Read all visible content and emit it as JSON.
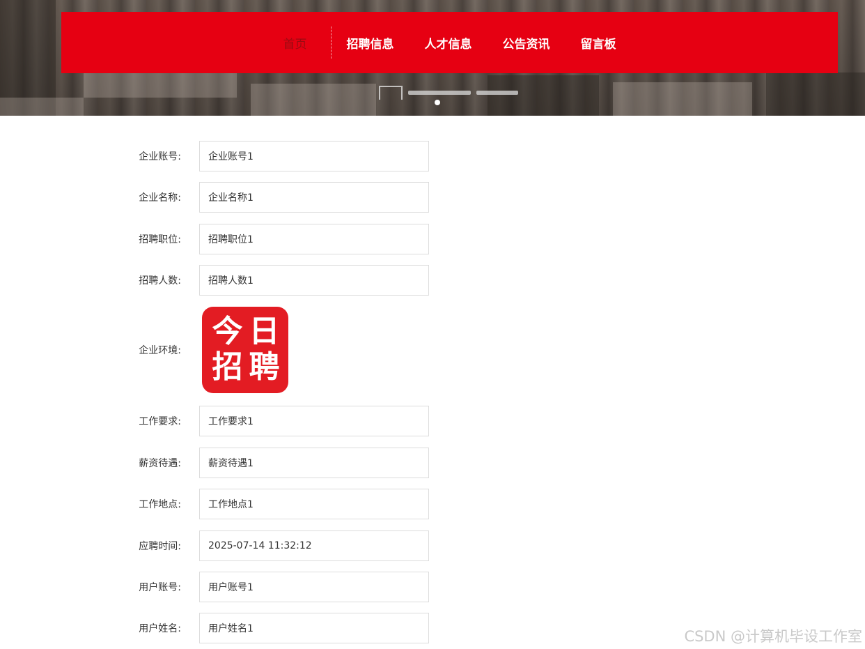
{
  "nav": {
    "items": [
      {
        "label": "首页",
        "active": true
      },
      {
        "label": "招聘信息",
        "active": false
      },
      {
        "label": "人才信息",
        "active": false
      },
      {
        "label": "公告资讯",
        "active": false
      },
      {
        "label": "留言板",
        "active": false
      }
    ]
  },
  "colors": {
    "brand_red": "#e60012"
  },
  "form": {
    "company_account": {
      "label": "企业账号:",
      "value": "企业账号1"
    },
    "company_name": {
      "label": "企业名称:",
      "value": "企业名称1"
    },
    "position": {
      "label": "招聘职位:",
      "value": "招聘职位1"
    },
    "headcount": {
      "label": "招聘人数:",
      "value": "招聘人数1"
    },
    "environment": {
      "label": "企业环境:",
      "image_text": [
        "今",
        "日",
        "招",
        "聘"
      ]
    },
    "requirements": {
      "label": "工作要求:",
      "value": "工作要求1"
    },
    "salary": {
      "label": "薪资待遇:",
      "value": "薪资待遇1"
    },
    "location": {
      "label": "工作地点:",
      "value": "工作地点1"
    },
    "apply_time": {
      "label": "应聘时间:",
      "value": "2025-07-14 11:32:12"
    },
    "user_account": {
      "label": "用户账号:",
      "value": "用户账号1"
    },
    "user_name": {
      "label": "用户姓名:",
      "value": "用户姓名1"
    }
  },
  "watermark": "CSDN @计算机毕设工作室"
}
